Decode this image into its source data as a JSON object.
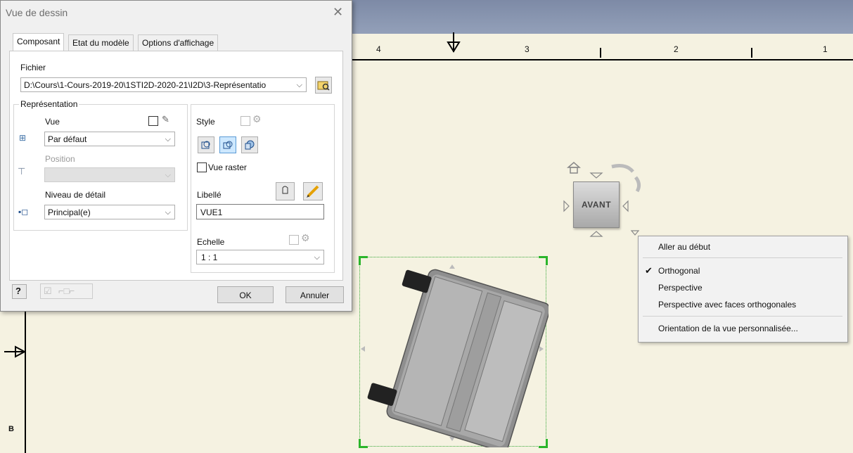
{
  "dialog": {
    "title": "Vue de dessin",
    "tabs": [
      {
        "label": "Composant",
        "active": true
      },
      {
        "label": "Etat du modèle",
        "active": false
      },
      {
        "label": "Options d'affichage",
        "active": false
      }
    ],
    "file_label": "Fichier",
    "file_path": "D:\\Cours\\1-Cours-2019-20\\1STI2D-2020-21\\I2D\\3-Représentatio",
    "representation": {
      "group_label": "Représentation",
      "vue_label": "Vue",
      "vue_value": "Par défaut",
      "position_label": "Position",
      "position_value": "",
      "detail_label": "Niveau de détail",
      "detail_value": "Principal(e)"
    },
    "style_label": "Style",
    "raster_label": "Vue raster",
    "raster_checked": false,
    "libelle_label": "Libellé",
    "libelle_value": "VUE1",
    "echelle_label": "Echelle",
    "echelle_value": "1 : 1",
    "ok_label": "OK",
    "cancel_label": "Annuler"
  },
  "ruler": {
    "labels": [
      "4",
      "3",
      "2",
      "1"
    ],
    "section_letter": "B"
  },
  "viewcube": {
    "face_label": "AVANT"
  },
  "context_menu": {
    "items": [
      {
        "label": "Aller au début",
        "checked": false
      },
      {
        "label": "Orthogonal",
        "checked": true
      },
      {
        "label": "Perspective",
        "checked": false
      },
      {
        "label": "Perspective avec faces orthogonales",
        "checked": false
      },
      {
        "label": "Orientation de la vue personnalisée...",
        "checked": false
      }
    ]
  },
  "colors": {
    "sheet_background": "#f5f2e1",
    "selection_green": "#2bb52b",
    "dialog_background": "#f0f0f0"
  }
}
